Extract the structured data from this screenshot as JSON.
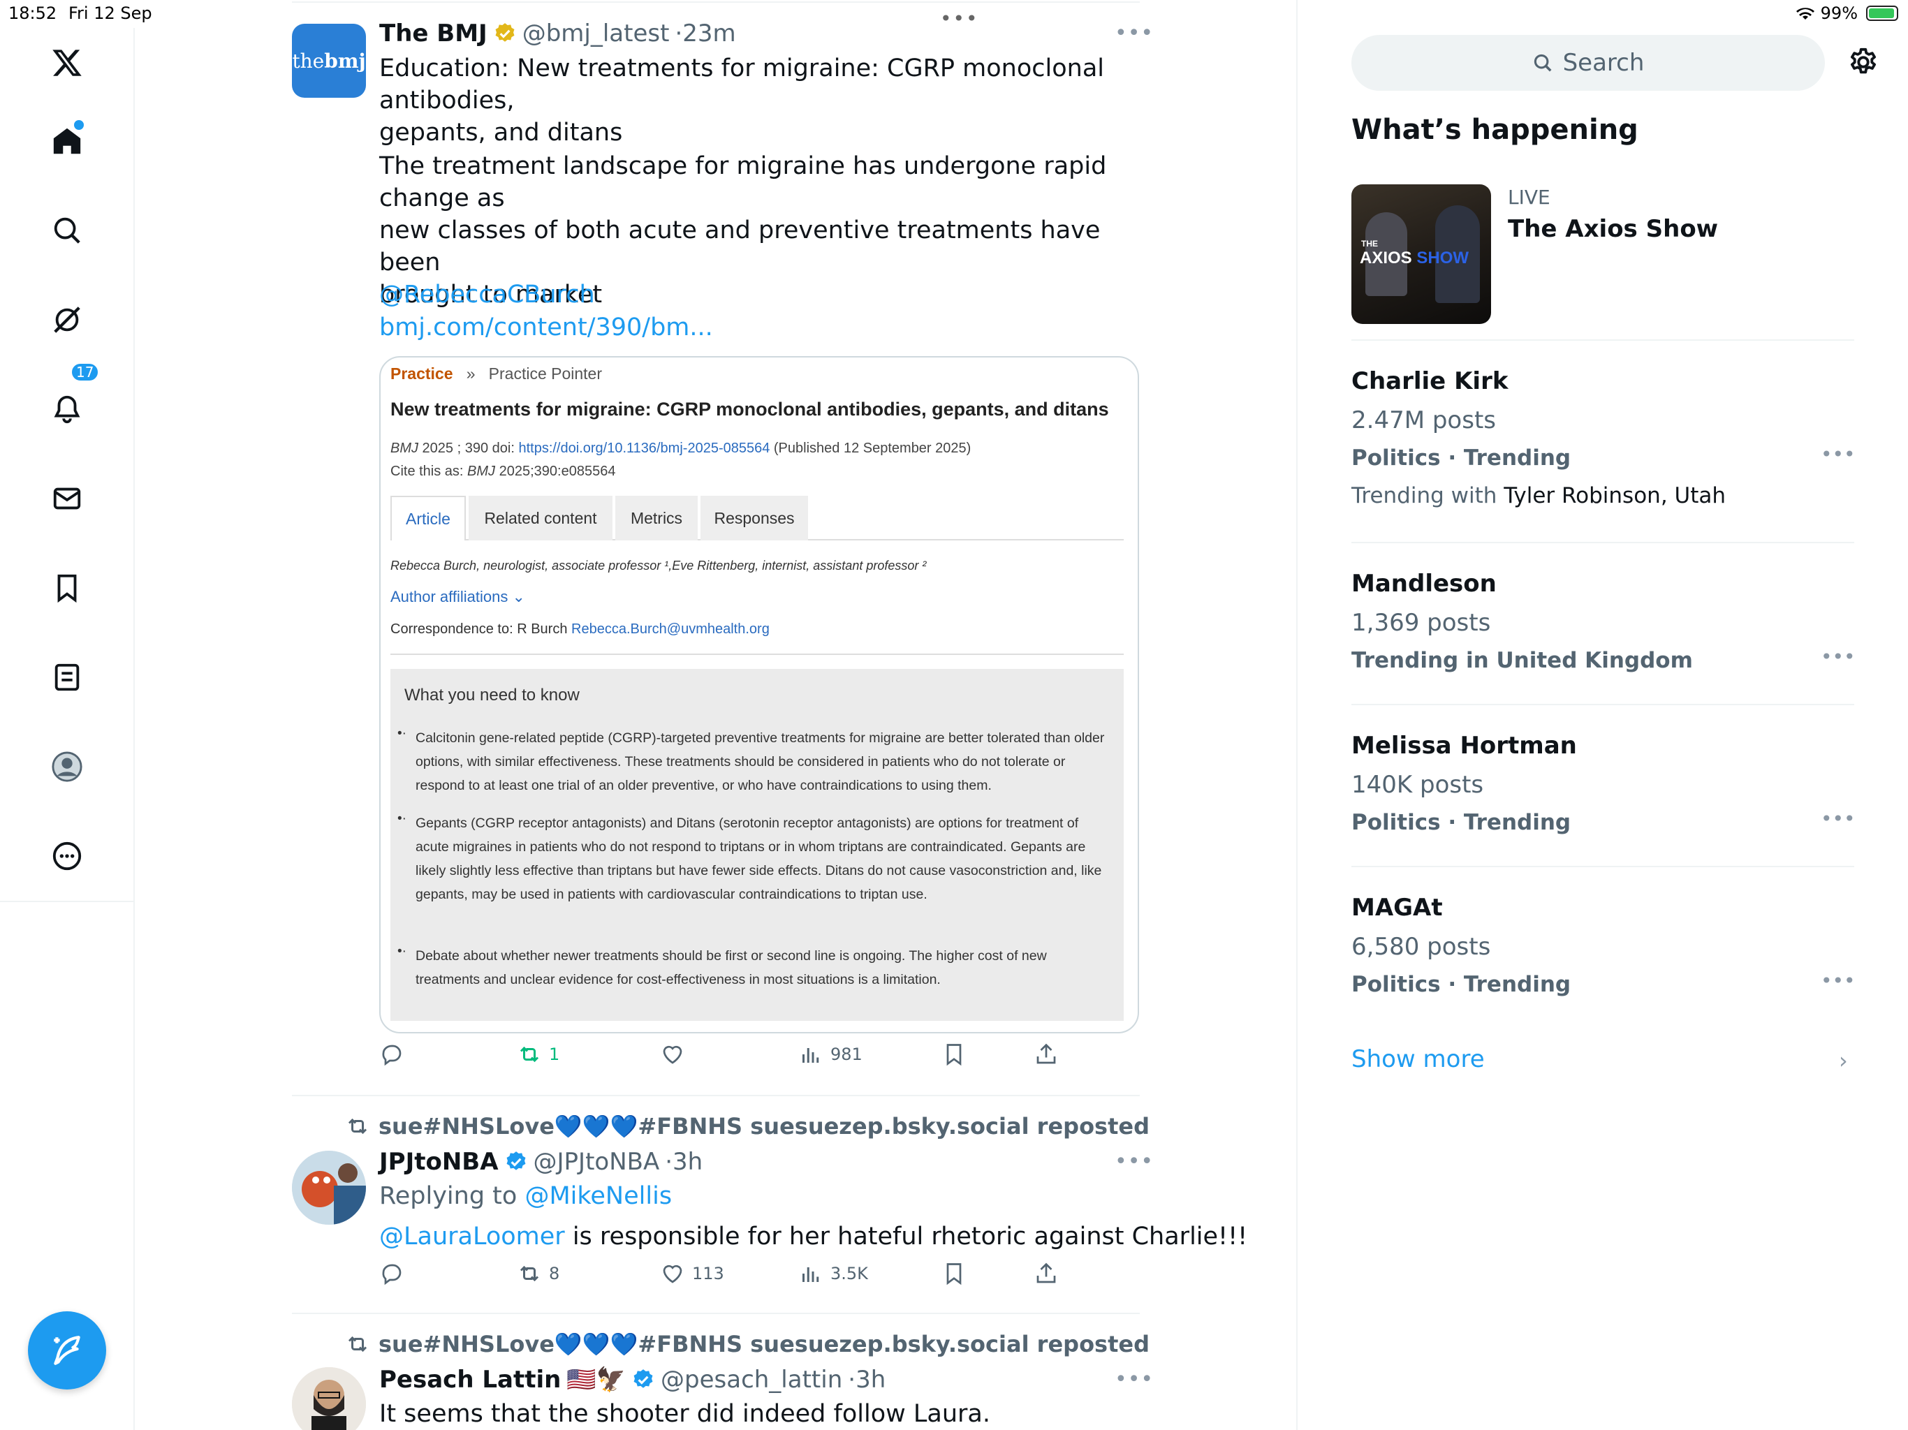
{
  "statusbar": {
    "time": "18:52",
    "date": "Fri 12 Sep",
    "battery": "99%"
  },
  "nav": {
    "notifications_count": "17"
  },
  "search": {
    "placeholder": "Search"
  },
  "sidebar": {
    "heading": "What’s happening",
    "live": {
      "label": "LIVE",
      "title": "The Axios Show",
      "thumb_text_the": "THE",
      "thumb_text_axios": "AXIOS",
      "thumb_text_show": "SHOW"
    },
    "trends": [
      {
        "name": "Charlie Kirk",
        "posts": "2.47M posts",
        "category": "Politics · Trending",
        "with_prefix": "Trending with",
        "with": "Tyler Robinson, Utah"
      },
      {
        "name": "Mandleson",
        "posts": "1,369 posts",
        "category": "Trending in United Kingdom"
      },
      {
        "name": "Melissa Hortman",
        "posts": "140K posts",
        "category": "Politics · Trending"
      },
      {
        "name": "MAGAt",
        "posts": "6,580 posts",
        "category": "Politics · Trending"
      }
    ],
    "show_more": "Show more"
  },
  "tweets": [
    {
      "avatar_text_1": "the",
      "avatar_text_2": "bmj",
      "name": "The BMJ",
      "handle": "@bmj_latest",
      "dot": "·",
      "time": "23m",
      "text_1": "Education: New treatments for migraine: CGRP monoclonal antibodies,\ngepants, and ditans",
      "text_2": "The treatment landscape for migraine has undergone rapid change as\nnew classes of both acute and preventive treatments have been\nbrought to market",
      "mention": "@RebeccaCBurch",
      "url": "bmj.com/content/390/bm...",
      "card": {
        "section": "Practice",
        "sep": "»",
        "subsection": "Practice Pointer",
        "title": "New treatments for migraine: CGRP monoclonal antibodies, gepants, and ditans",
        "cite_1_journal": "BMJ",
        "cite_1_rest": " 2025 ; 390  doi: ",
        "doi": "https://doi.org/10.1136/bmj-2025-085564",
        "published": " (Published 12 September 2025)",
        "cite_2_prefix": "Cite this as: ",
        "cite_2_journal": "BMJ",
        "cite_2_rest": " 2025;390:e085564",
        "tabs": [
          "Article",
          "Related content",
          "Metrics",
          "Responses"
        ],
        "authors": "Rebecca Burch, neurologist, associate professor ¹,Eve Rittenberg, internist, assistant professor ²",
        "affiliations": "Author affiliations ⌄",
        "correspondence_prefix": "Correspondence to: R Burch ",
        "correspondence_email": "Rebecca.Burch@uvmhealth.org",
        "box_heading": "What you need to know",
        "bullets": [
          "Calcitonin gene-related peptide (CGRP)-targeted preventive treatments for migraine are better tolerated than older options, with similar effectiveness. These treatments should be considered in patients who do not tolerate or respond to at least one trial of an older preventive, or who have contraindications to using them.",
          "Gepants (CGRP receptor antagonists) and Ditans (serotonin receptor antagonists) are options for treatment of acute migraines in patients who do not respond to triptans or in whom triptans are contraindicated. Gepants are likely slightly less effective than triptans but have fewer side effects. Ditans do not cause vasoconstriction and, like gepants, may be used in patients with cardiovascular contraindications to triptan use.",
          "Debate about whether newer treatments should be first or second line is ongoing. The higher cost of new treatments and unclear evidence for cost-effectiveness in most situations is a limitation."
        ],
        "bullet_mark": "•·"
      },
      "reposts": "1",
      "views": "981"
    },
    {
      "reposted_by": "sue#NHSLove💙💙💙#FBNHS suesuezep.bsky.social reposted",
      "name": "JPJtoNBA",
      "handle": "@JPJtoNBA",
      "dot": "·",
      "time": "3h",
      "reply_prefix": "Replying to ",
      "reply_to": "@MikeNellis",
      "mention": "@LauraLoomer",
      "text": " is responsible for her hateful rhetoric against Charlie!!!",
      "reposts": "8",
      "likes": "113",
      "views": "3.5K"
    },
    {
      "reposted_by": "sue#NHSLove💙💙💙#FBNHS suesuezep.bsky.social reposted",
      "name": "Pesach Lattin",
      "emoji": "🇺🇸🦅",
      "handle": "@pesach_lattin",
      "dot": "·",
      "time": "3h",
      "text": "It seems that the shooter did indeed follow Laura."
    }
  ],
  "colors": {
    "accent": "#1d9bf0",
    "repost_green": "#00ba7c",
    "gold_verified": "#e2b719",
    "muted": "#536471"
  }
}
